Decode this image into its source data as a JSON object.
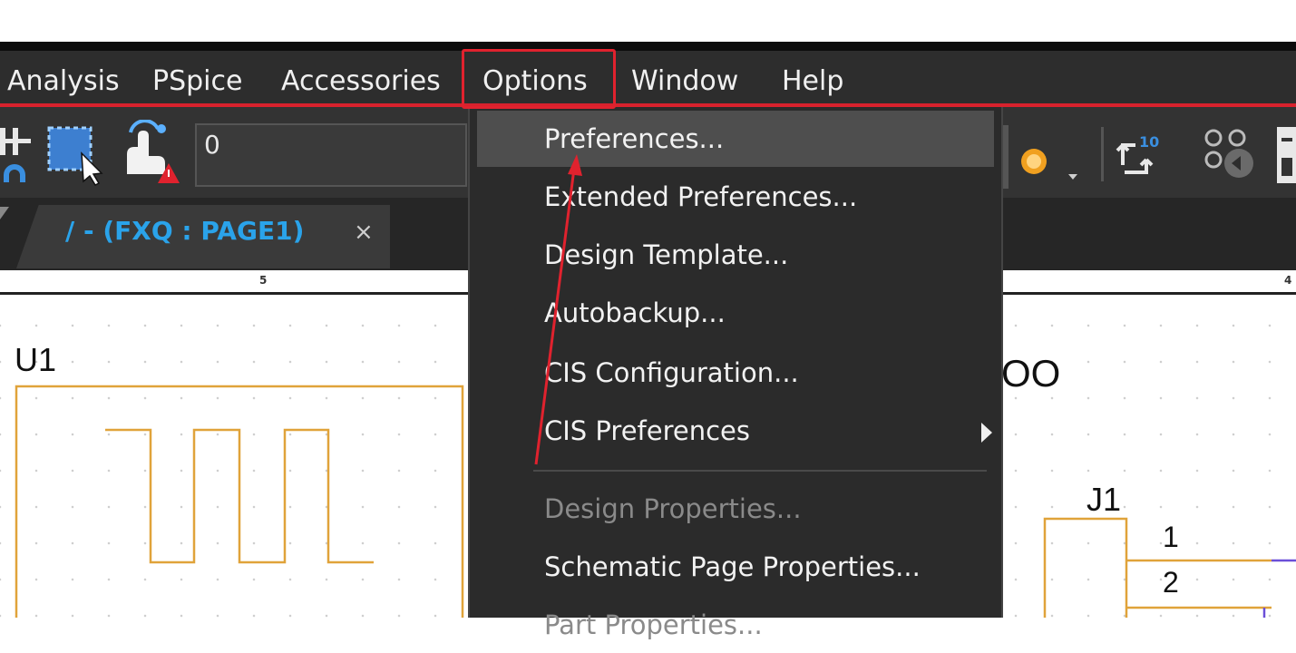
{
  "menubar": {
    "items": [
      {
        "label": "Analysis"
      },
      {
        "label": "PSpice"
      },
      {
        "label": "Accessories"
      },
      {
        "label": "Options"
      },
      {
        "label": "Window"
      },
      {
        "label": "Help"
      }
    ]
  },
  "toolbar": {
    "field_value": "0",
    "icon_badge": "10"
  },
  "tab": {
    "title": "/ - (FXQ : PAGE1)",
    "close": "×"
  },
  "ruler": {
    "tick_left": "5",
    "tick_right": "4"
  },
  "schematic": {
    "u1_label": "U1",
    "j1_label": "J1",
    "pin1": "1",
    "pin2": "2",
    "partial_text": "OO"
  },
  "options_menu": {
    "items": [
      {
        "label": "Preferences...",
        "disabled": false
      },
      {
        "label": "Extended Preferences...",
        "disabled": false
      },
      {
        "label": "Design Template...",
        "disabled": false
      },
      {
        "label": "Autobackup...",
        "disabled": false
      },
      {
        "label": "CIS Configuration...",
        "disabled": false
      },
      {
        "label": "CIS Preferences",
        "disabled": false,
        "submenu": true
      },
      {
        "label": "Design Properties...",
        "disabled": true
      },
      {
        "label": "Schematic Page Properties...",
        "disabled": false
      },
      {
        "label": "Part Properties...",
        "disabled": true
      }
    ]
  },
  "colors": {
    "highlight_red": "#e0222e",
    "tab_text": "#2aa3ea",
    "wire_orange": "#e0a33a"
  }
}
